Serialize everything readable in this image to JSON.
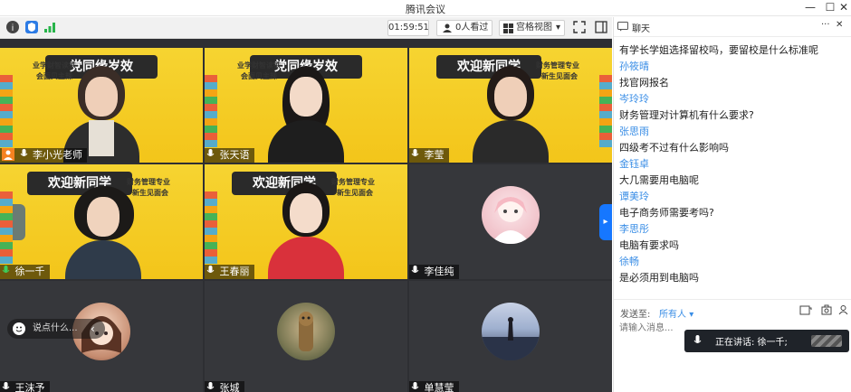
{
  "window": {
    "title": "腾讯会议",
    "minimize": "—",
    "maximize": "☐",
    "close": "✕"
  },
  "toolbar": {
    "timer": "01:59:51",
    "viewers": "0人看过",
    "layout": "宫格视图"
  },
  "tiles": [
    {
      "name": "李小光老师",
      "banner": "党同缘岁效",
      "sub_left": "业学财智读铁",
      "sub_right": "会面贝主辣",
      "style": "yellow"
    },
    {
      "name": "张天语",
      "banner": "党同缘岁效",
      "sub_left": "业学财智读铁",
      "sub_right": "会面贝主辣",
      "style": "yellow"
    },
    {
      "name": "李莹",
      "banner": "欢迎新同学",
      "sub_left": "",
      "sub_right": "财务管理专业",
      "sub_right2": "新生见面会",
      "style": "yellow"
    },
    {
      "name": "徐一千",
      "banner": "欢迎新同学",
      "sub_left": "",
      "sub_right": "财务管理专业",
      "sub_right2": "新生见面会",
      "style": "yellow"
    },
    {
      "name": "王春丽",
      "banner": "欢迎新同学",
      "sub_left": "",
      "sub_right": "财务管理专业",
      "sub_right2": "新生见面会",
      "style": "yellow"
    },
    {
      "name": "李佳纯",
      "style": "dark"
    },
    {
      "name": "王沫予",
      "style": "dark"
    },
    {
      "name": "张城",
      "style": "dark"
    },
    {
      "name": "单慧莹",
      "style": "dark"
    }
  ],
  "comment_bar": {
    "placeholder": "说点什么..."
  },
  "chat": {
    "title": "聊天",
    "more": "···",
    "close": "✕",
    "messages": [
      {
        "sender": "",
        "text": "有学长学姐选择留校吗，要留校是什么标准呢"
      },
      {
        "sender": "孙筱晴",
        "text": "找官网报名"
      },
      {
        "sender": "岑玲玲",
        "text": "财务管理对计算机有什么要求?"
      },
      {
        "sender": "张思雨",
        "text": "四级考不过有什么影响吗"
      },
      {
        "sender": "金钰卓",
        "text": "大几需要用电脑呢"
      },
      {
        "sender": "谭美玲",
        "text": "电子商务师需要考吗?"
      },
      {
        "sender": "李思彤",
        "text": "电脑有要求吗"
      },
      {
        "sender": "徐畅",
        "text": "是必须用到电脑吗"
      }
    ],
    "send_to_label": "发送至:",
    "send_to_value": "所有人",
    "input_placeholder": "请输入消息...",
    "speaking_label": "正在讲话: 徐一千;"
  },
  "colors": {
    "accent": "#3a8ee6",
    "banner_yellow": "#f4cb22",
    "grid_bg": "#2e2f33",
    "blue_tab": "#1677ff"
  }
}
